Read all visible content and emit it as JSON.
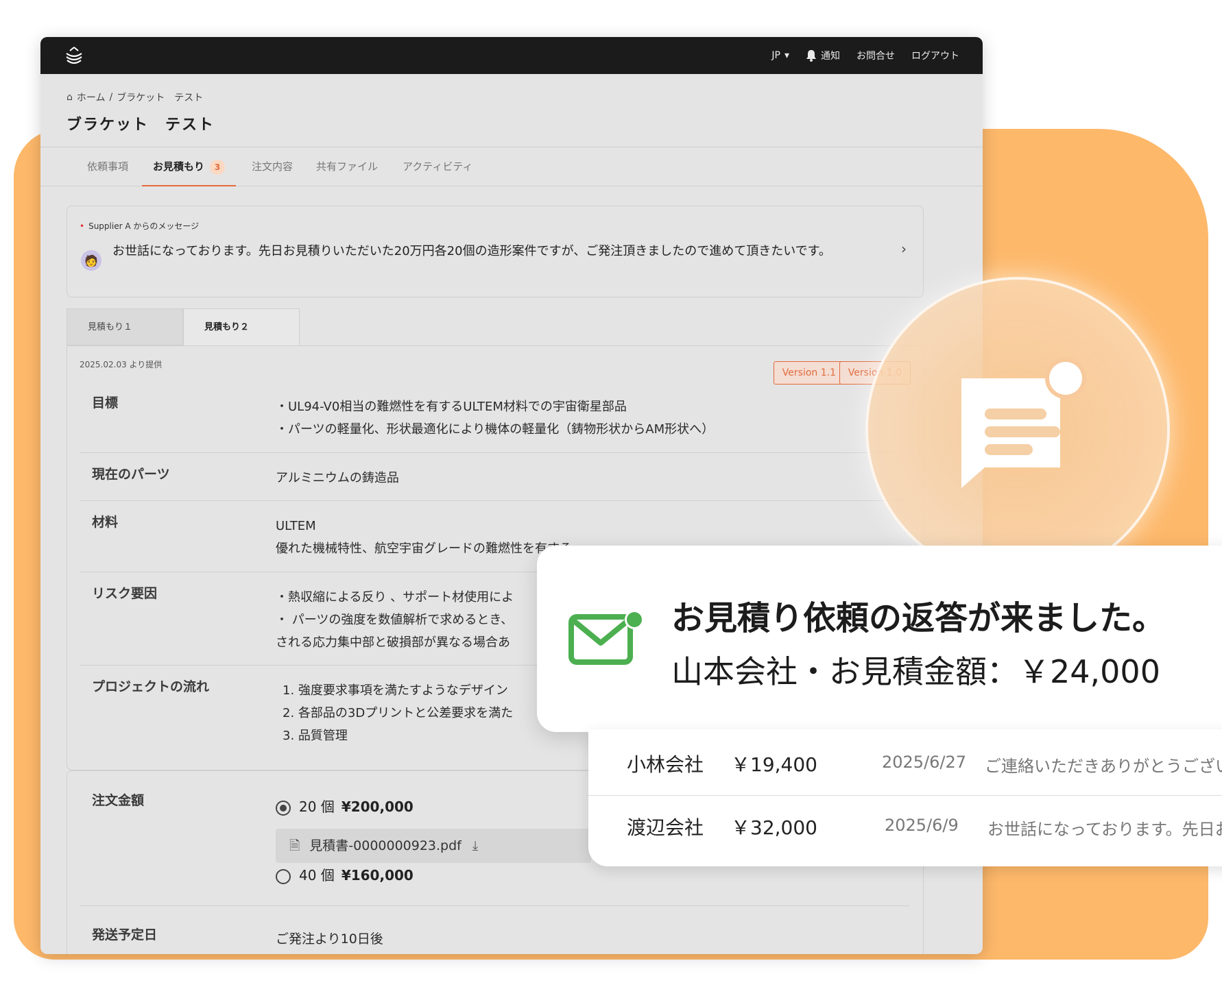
{
  "topbar": {
    "lang": "JP",
    "notify": "通知",
    "contact": "お問合せ",
    "logout": "ログアウト"
  },
  "breadcrumb": {
    "home": "ホーム",
    "sep": "/",
    "current": "ブラケット　テスト"
  },
  "page_title": "ブラケット　テスト",
  "tabs": [
    {
      "label": "依頼事項"
    },
    {
      "label": "お見積もり",
      "badge": "3"
    },
    {
      "label": "注文内容"
    },
    {
      "label": "共有ファイル"
    },
    {
      "label": "アクティビティ"
    }
  ],
  "message": {
    "from": "Supplier A からのメッセージ",
    "text": "お世話になっております。先日お見積りいただいた20万円各20個の造形案件ですが、ご発注頂きましたので進めて頂きたいです。"
  },
  "quote_tabs": [
    "見積もり１",
    "見積もり２"
  ],
  "quote": {
    "provided": "2025.02.03 より提供",
    "versions": [
      "Version 1.1",
      "Version 1.0"
    ],
    "rows": [
      {
        "label": "目標",
        "lines": [
          "・UL94-V0相当の難燃性を有するULTEM材料での宇宙衛星部品",
          "・パーツの軽量化、形状最適化により機体の軽量化（鋳物形状からAM形状へ）"
        ]
      },
      {
        "label": "現在のパーツ",
        "lines": [
          "アルミニウムの鋳造品"
        ]
      },
      {
        "label": "材料",
        "lines": [
          "ULTEM",
          "優れた機械特性、航空宇宙グレードの難燃性を有する"
        ]
      },
      {
        "label": "リスク要因",
        "lines": [
          "・熱収縮による反り 、サポート材使用によ",
          "・ パーツの強度を数値解析で求めるとき、",
          "される応力集中部と破損部が異なる場合あ"
        ]
      },
      {
        "label": "プロジェクトの流れ",
        "lines": [
          "1. 強度要求事項を満たすようなデザイン",
          "2. 各部品の3Dプリントと公差要求を満た",
          "3. 品質管理"
        ]
      }
    ]
  },
  "order": {
    "amount_label": "注文金額",
    "options": [
      {
        "qty": "20 個",
        "price": "¥200,000",
        "selected": true
      },
      {
        "qty": "40 個",
        "price": "¥160,000",
        "selected": false
      }
    ],
    "file": "見積書-0000000923.pdf",
    "ship_label": "発送予定日",
    "ship_value": "ご発注より10日後"
  },
  "notification": {
    "title": "お見積り依頼の返答が来ました。",
    "subtitle": "山本会社・お見積金額：￥24,000",
    "accent": "#4caf50"
  },
  "quote_list": [
    {
      "company": "小林会社",
      "amount": "￥19,400",
      "date": "2025/6/27",
      "preview": "ご連絡いただきありがとうござい"
    },
    {
      "company": "渡辺会社",
      "amount": "￥32,000",
      "date": "2025/6/9",
      "preview": "お世話になっております。先日お"
    }
  ],
  "colors": {
    "accent": "#e26b3e",
    "background_shape": "#fdb86a",
    "topbar": "#1b1b1b"
  }
}
